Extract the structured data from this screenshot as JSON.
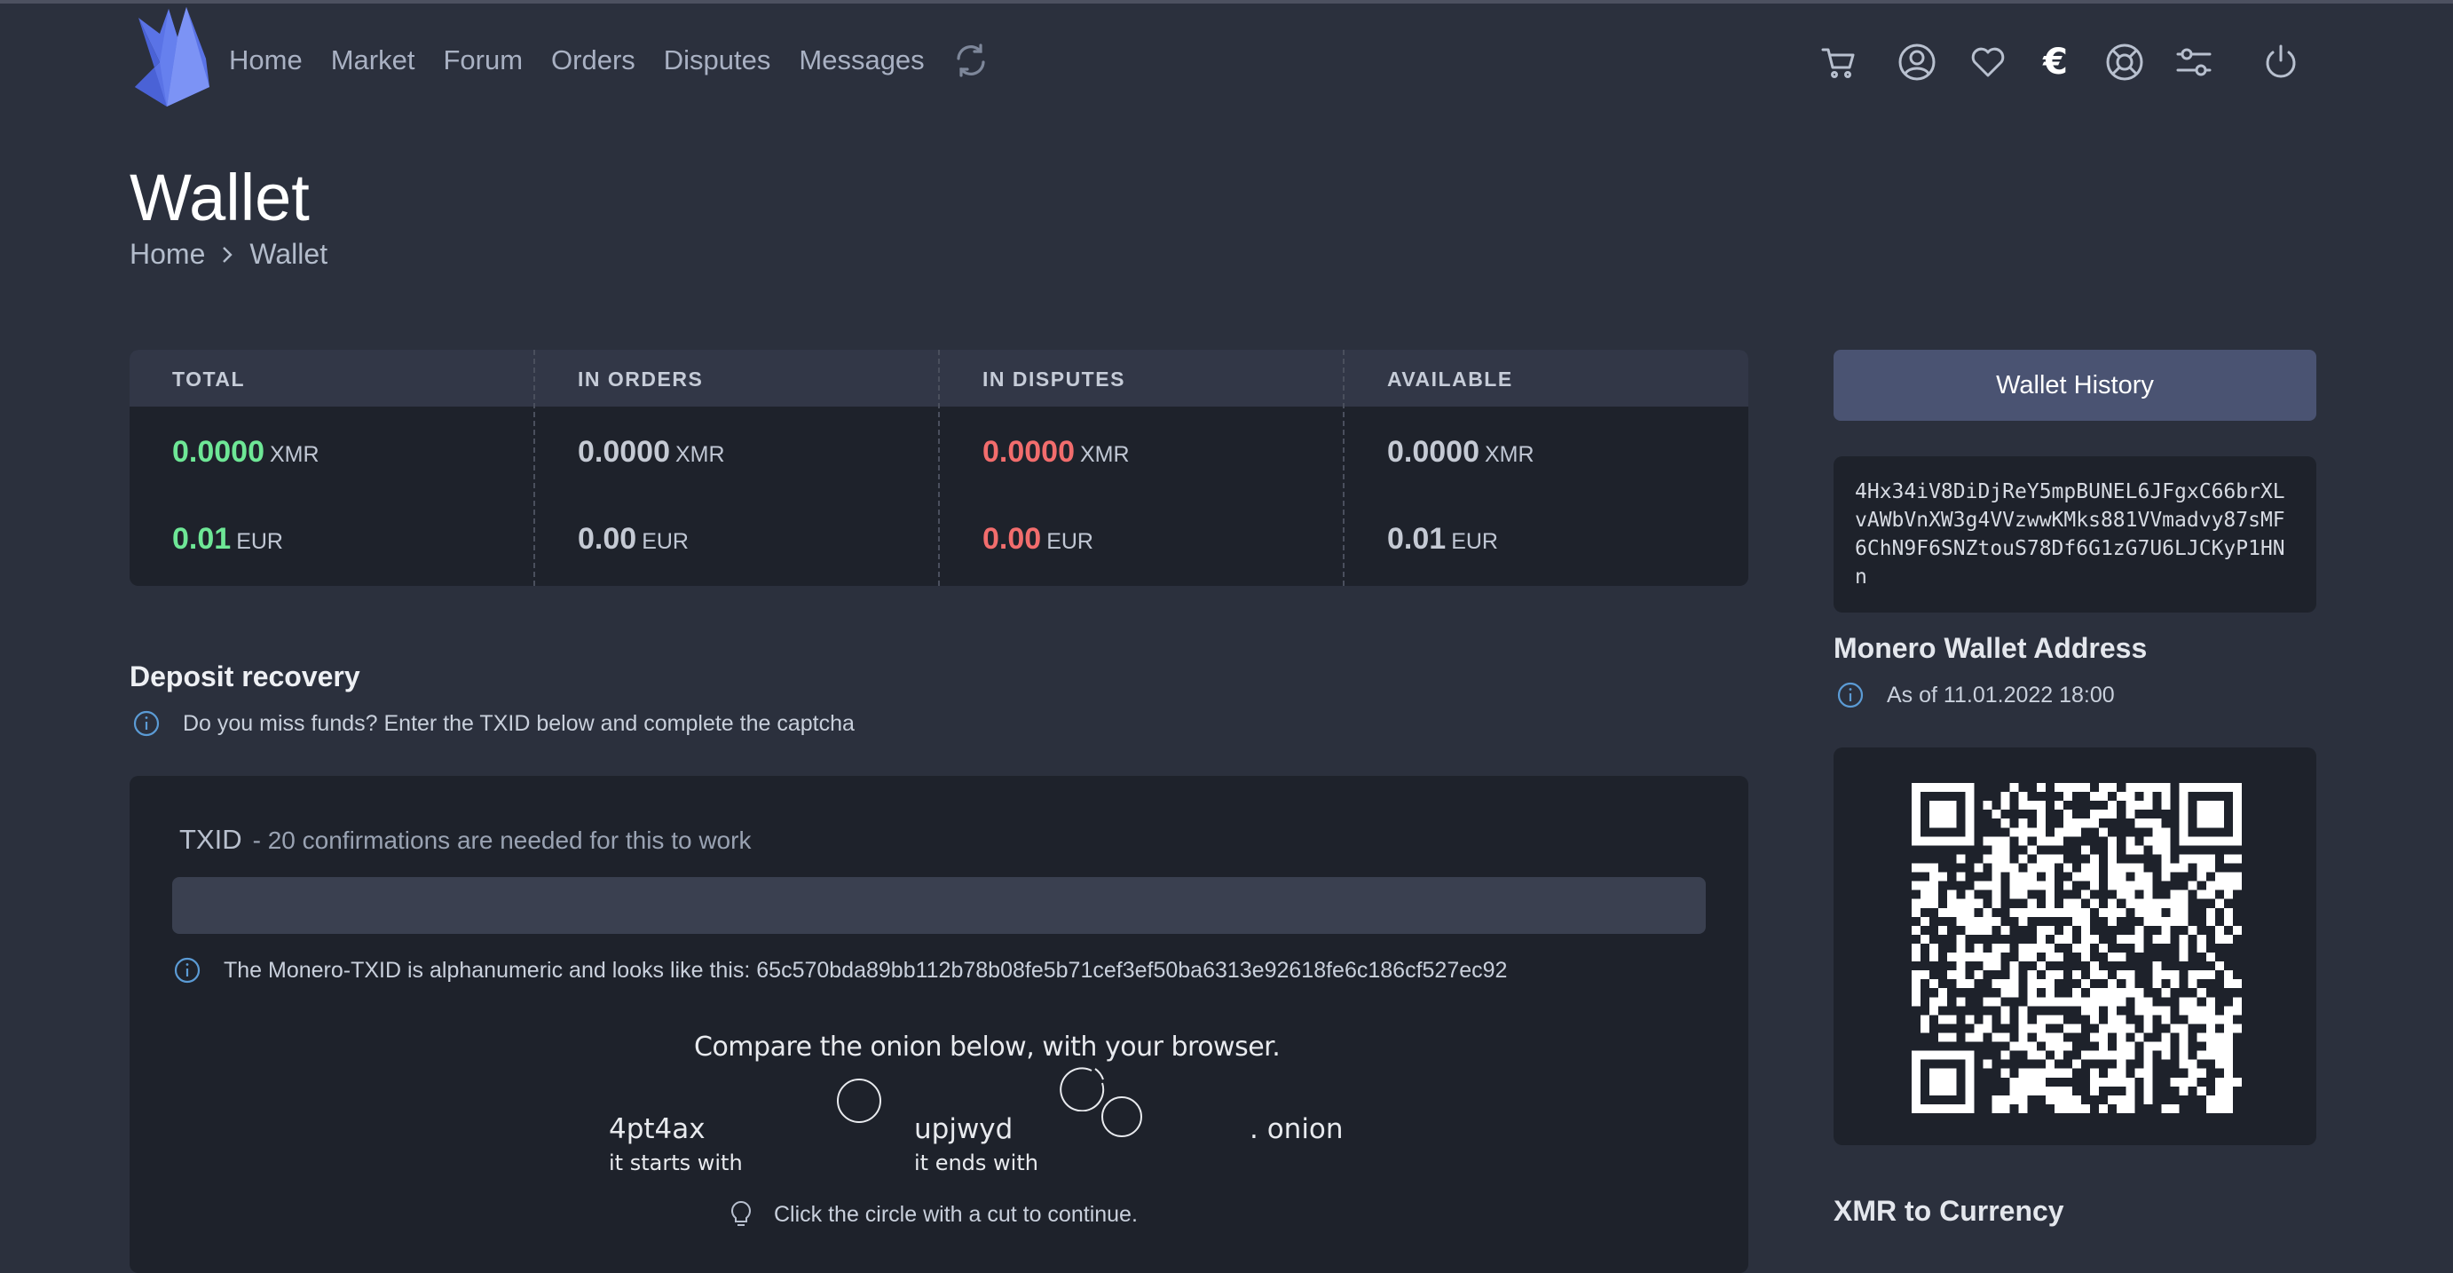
{
  "nav": {
    "links": [
      "Home",
      "Market",
      "Forum",
      "Orders",
      "Disputes",
      "Messages"
    ],
    "currency_symbol": "€",
    "icons": [
      "refresh-icon",
      "cart-icon",
      "user-icon",
      "heart-icon",
      "euro-icon",
      "support-icon",
      "settings-icon",
      "power-icon"
    ]
  },
  "page": {
    "title": "Wallet",
    "breadcrumb": [
      "Home",
      "Wallet"
    ]
  },
  "balances": {
    "columns": [
      {
        "label": "TOTAL",
        "xmr": "0.0000",
        "xmr_unit": "XMR",
        "eur": "0.01",
        "eur_unit": "EUR",
        "color": "#6ee796"
      },
      {
        "label": "IN ORDERS",
        "xmr": "0.0000",
        "xmr_unit": "XMR",
        "eur": "0.00",
        "eur_unit": "EUR",
        "color": "#c5cad4"
      },
      {
        "label": "IN DISPUTES",
        "xmr": "0.0000",
        "xmr_unit": "XMR",
        "eur": "0.00",
        "eur_unit": "EUR",
        "color": "#f26d6d"
      },
      {
        "label": "AVAILABLE",
        "xmr": "0.0000",
        "xmr_unit": "XMR",
        "eur": "0.01",
        "eur_unit": "EUR",
        "color": "#c5cad4"
      }
    ]
  },
  "deposit": {
    "title": "Deposit recovery",
    "info": "Do you miss funds? Enter the TXID below and complete the captcha",
    "txid_label": "TXID",
    "txid_sublabel": "- 20 confirmations are needed for this to work",
    "txid_value": "",
    "txid_hint": "The Monero-TXID is alphanumeric and looks like this: 65c570bda89bb112b78b08fe5b71cef3ef50ba6313e92618fe6c186cf527ec92",
    "captcha": {
      "heading": "Compare the onion below, with your browser.",
      "start": "4pt4ax",
      "start_caption": "it starts with",
      "end": "upjwyd",
      "end_caption": "it ends with",
      "suffix": ". onion"
    },
    "continue_hint": "Click the circle with a cut to continue."
  },
  "sidebar": {
    "history_button": "Wallet History",
    "address": "4Hx34iV8DiDjReY5mpBUNEL6JFgxC66brXLvAWbVnXW3g4VVzwwKMks881VVmadvy87sMF6ChN9F6SNZtouS78Df6G1zG7U6LJCKyP1HNn",
    "address_title": "Monero Wallet Address",
    "as_of": "As of 11.01.2022 18:00",
    "converter_title": "XMR to Currency"
  },
  "colors": {
    "background": "#2b303d",
    "panel": "#1e222b",
    "accent_button": "#4a5372",
    "positive": "#6ee796",
    "negative": "#f26d6d",
    "info": "#5b9bd5"
  }
}
